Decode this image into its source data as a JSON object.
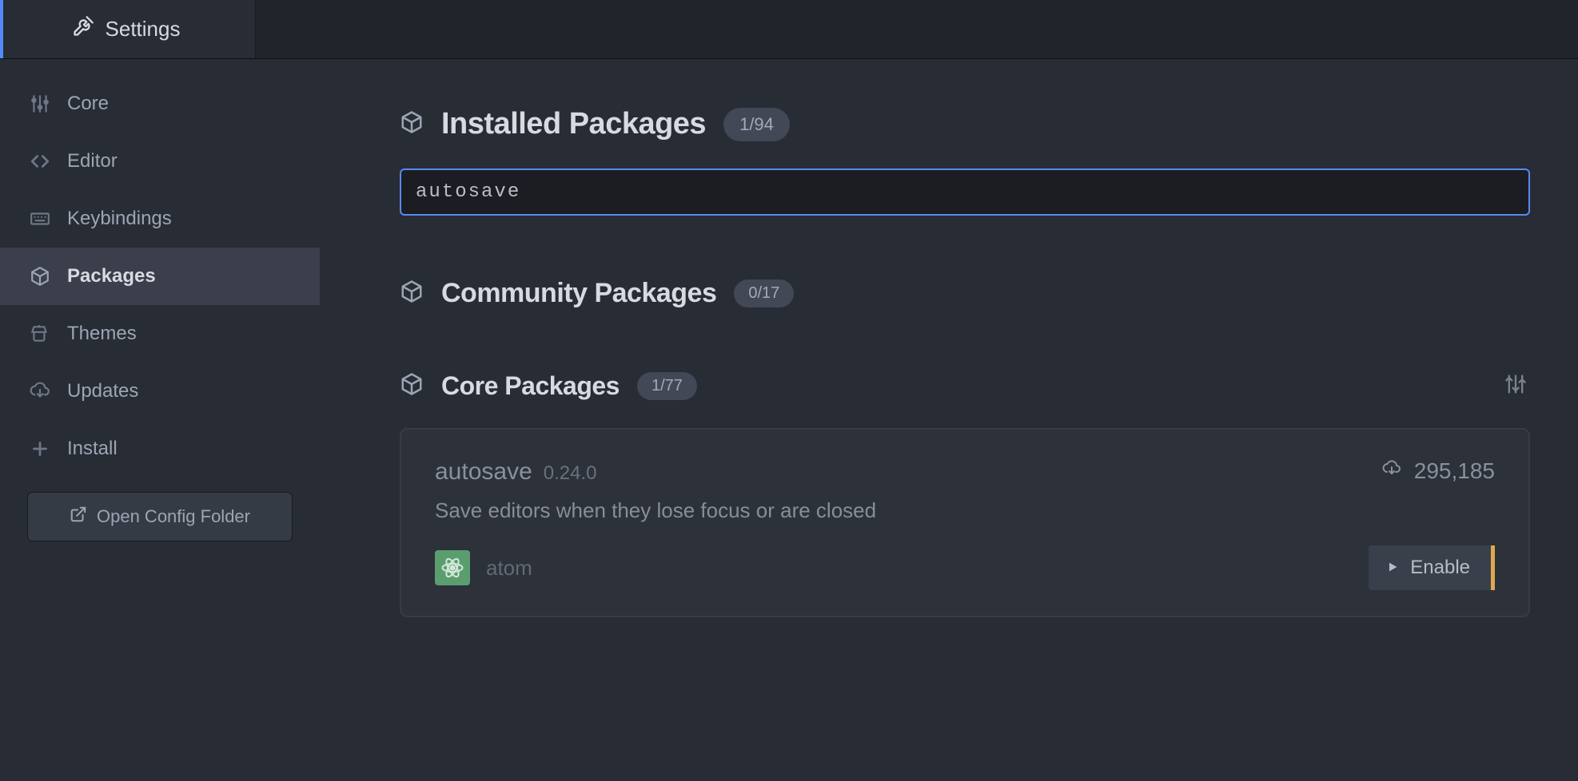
{
  "tab": {
    "title": "Settings"
  },
  "sidebar": {
    "items": [
      {
        "label": "Core",
        "icon": "sliders"
      },
      {
        "label": "Editor",
        "icon": "code"
      },
      {
        "label": "Keybindings",
        "icon": "keyboard"
      },
      {
        "label": "Packages",
        "icon": "package",
        "active": true
      },
      {
        "label": "Themes",
        "icon": "bucket"
      },
      {
        "label": "Updates",
        "icon": "cloud-download"
      },
      {
        "label": "Install",
        "icon": "plus"
      }
    ],
    "open_config": "Open Config Folder"
  },
  "main": {
    "installed": {
      "title": "Installed Packages",
      "count": "1/94"
    },
    "search": {
      "value": "autosave",
      "placeholder": "Filter packages by name"
    },
    "community": {
      "title": "Community Packages",
      "count": "0/17"
    },
    "core": {
      "title": "Core Packages",
      "count": "1/77"
    },
    "package": {
      "name": "autosave",
      "version": "0.24.0",
      "downloads": "295,185",
      "description": "Save editors when they lose focus or are closed",
      "author": "atom",
      "enable_label": "Enable"
    }
  }
}
